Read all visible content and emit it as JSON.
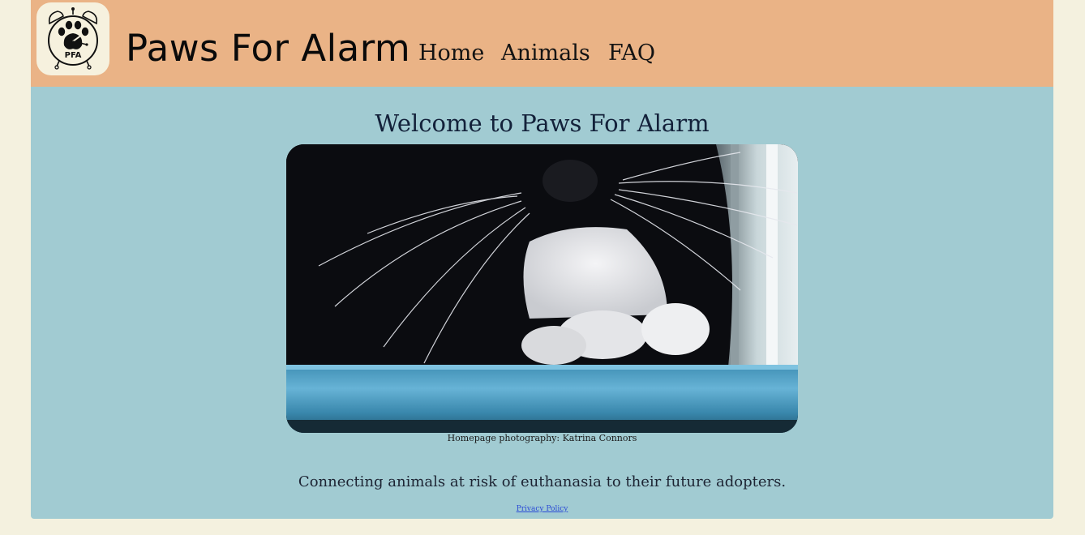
{
  "header": {
    "logo_text": "PFA",
    "site_title": "Paws For Alarm",
    "nav": [
      {
        "label": "Home"
      },
      {
        "label": "Animals"
      },
      {
        "label": "FAQ"
      }
    ],
    "background_color": "#eab386"
  },
  "main": {
    "heading": "Welcome to Paws For Alarm",
    "hero_image_icon": "tuxedo-cat-photo",
    "photo_credit": "Homepage photography: Katrina Connors",
    "tagline": "Connecting animals at risk of euthanasia to their future adopters.",
    "background_color": "#a1cbd2"
  },
  "footer": {
    "privacy_link": "Privacy Policy"
  }
}
